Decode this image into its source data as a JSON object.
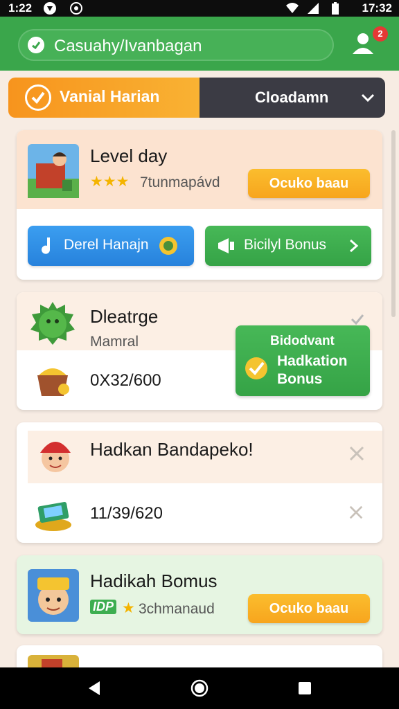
{
  "status_bar": {
    "time_left": "1:22",
    "time_right": "17:32"
  },
  "header": {
    "search_text": "Casuahy/Ivanbagan",
    "notification_count": "2"
  },
  "tabs": {
    "active_label": "Vanial Harian",
    "dropdown_label": "Cloadamn"
  },
  "level_card": {
    "title": "Level day",
    "rating_text": "7tunmapávd",
    "stars": 3,
    "button_label": "Ocuko baau",
    "pill_left_label": "Derel Hanajn",
    "pill_right_label": "Bicilyl Bonus"
  },
  "challenge_card": {
    "title": "Dleatrge",
    "subtitle": "Mamral",
    "amount": "0X32/600",
    "popup_line1": "Bidodvant",
    "popup_line2": "Hadkation",
    "popup_line3": "Bonus"
  },
  "hadkan_card": {
    "title": "Hadkan Bandapeko!",
    "amount": "11/39/620"
  },
  "bonus_card": {
    "title": "Hadikah Bomus",
    "tag": "IDP",
    "rating_text": "3chmanaud",
    "button_label": "Ocuko baau"
  },
  "colors": {
    "header_green": "#3aa64b",
    "tab_orange": "#f7941d",
    "tab_dark": "#3b3b44",
    "button_orange": "#f9b233",
    "pill_blue": "#2f8ee5",
    "pill_green": "#3dae50"
  }
}
